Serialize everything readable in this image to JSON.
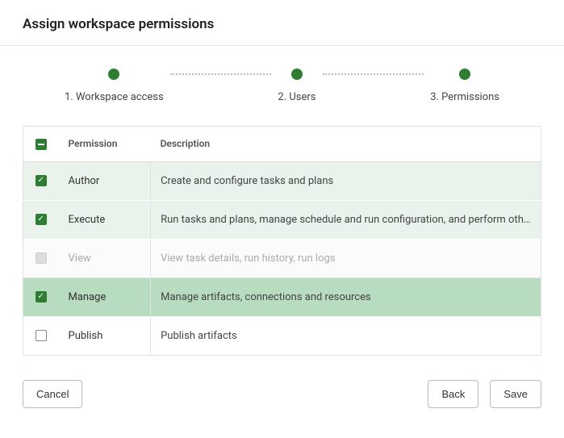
{
  "title": "Assign workspace permissions",
  "stepper": {
    "steps": [
      {
        "label": "1. Workspace access"
      },
      {
        "label": "2. Users"
      },
      {
        "label": "3. Permissions"
      }
    ]
  },
  "table": {
    "headers": {
      "permission": "Permission",
      "description": "Description"
    },
    "rows": [
      {
        "name": "Author",
        "description": "Create and configure tasks and plans",
        "checked": true,
        "disabled": false,
        "selected": false
      },
      {
        "name": "Execute",
        "description": "Run tasks and plans, manage schedule and run configuration, and perform other execution-related actions",
        "checked": true,
        "disabled": false,
        "selected": false
      },
      {
        "name": "View",
        "description": "View task details, run history, run logs",
        "checked": false,
        "disabled": true,
        "selected": false
      },
      {
        "name": "Manage",
        "description": "Manage artifacts, connections and resources",
        "checked": true,
        "disabled": false,
        "selected": true
      },
      {
        "name": "Publish",
        "description": "Publish artifacts",
        "checked": false,
        "disabled": false,
        "selected": false
      }
    ]
  },
  "footer": {
    "cancel": "Cancel",
    "back": "Back",
    "save": "Save"
  }
}
